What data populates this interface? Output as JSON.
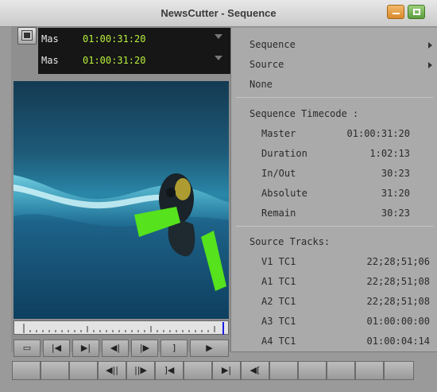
{
  "window": {
    "title": "NewsCutter - Sequence"
  },
  "timecode": {
    "rows": [
      {
        "label": "Mas",
        "value": "01:00:31:20"
      },
      {
        "label": "Mas",
        "value": "01:00:31:20"
      }
    ]
  },
  "menu": {
    "top_items": [
      {
        "label": "Sequence",
        "has_submenu": true
      },
      {
        "label": "Source",
        "has_submenu": true
      },
      {
        "label": "None",
        "has_submenu": false
      }
    ],
    "sequence_header": "Sequence Timecode :",
    "sequence_timecode": [
      {
        "name": "Master",
        "value": "01:00:31:20"
      },
      {
        "name": "Duration",
        "value": "1:02:13"
      },
      {
        "name": "In/Out",
        "value": "30:23"
      },
      {
        "name": "Absolute",
        "value": "31:20"
      },
      {
        "name": "Remain",
        "value": "30:23"
      }
    ],
    "source_header": "Source Tracks:",
    "source_tracks": [
      {
        "name": "V1 TC1",
        "value": "22;28;51;06"
      },
      {
        "name": "A1 TC1",
        "value": "22;28;51;08"
      },
      {
        "name": "A2 TC1",
        "value": "22;28;51;08"
      },
      {
        "name": "A3 TC1",
        "value": "01:00:00:00"
      },
      {
        "name": "A4 TC1",
        "value": "01:00:04:14"
      }
    ]
  },
  "transport": {
    "row1": [
      "▭",
      "|◀",
      "▶|",
      "◀|",
      "|▶",
      "]",
      "▶"
    ],
    "row2": [
      "",
      "",
      "",
      "◀||",
      "||▶",
      "]◀",
      "",
      "▶|",
      "",
      "◀[",
      "",
      "",
      "",
      "",
      ""
    ]
  },
  "colors": {
    "timecode_text": "#b8f03c",
    "menu_background": "#aaaaaa",
    "minimize_button": "#e39a3c",
    "maximize_button": "#6fae4c"
  }
}
